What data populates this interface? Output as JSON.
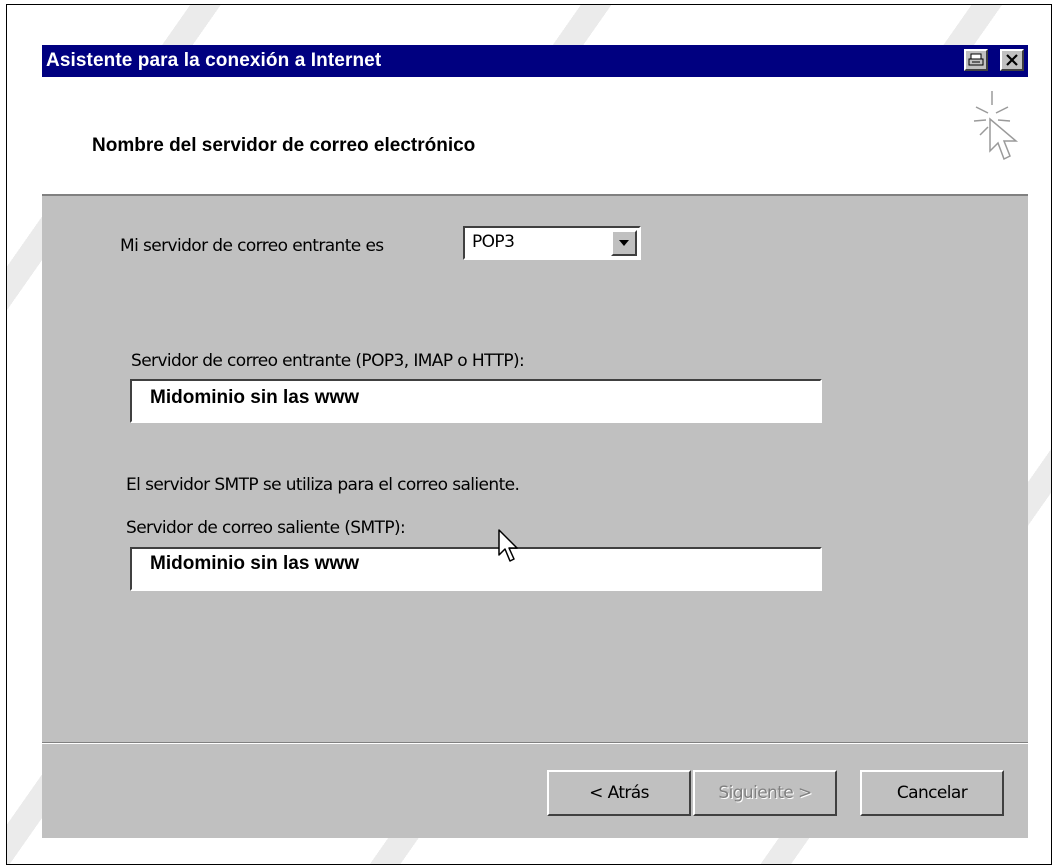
{
  "window": {
    "title": "Asistente para la conexión a Internet"
  },
  "header": {
    "title": "Nombre del servidor de correo electrónico"
  },
  "incoming_type": {
    "label": "Mi servidor de correo entrante es",
    "selected": "POP3"
  },
  "incoming_server": {
    "label": "Servidor de correo entrante (POP3, IMAP o HTTP):",
    "value": "Midominio sin las www"
  },
  "smtp_note": "El servidor SMTP se utiliza para el correo saliente.",
  "outgoing_server": {
    "label": "Servidor de correo saliente (SMTP):",
    "value": "Midominio sin las www"
  },
  "buttons": {
    "back": "< Atrás",
    "next": "Siguiente >",
    "cancel": "Cancelar"
  },
  "icons": [
    "print-icon",
    "close-icon",
    "wizard-cursor-icon",
    "dropdown-arrow-icon",
    "mouse-pointer-icon"
  ]
}
